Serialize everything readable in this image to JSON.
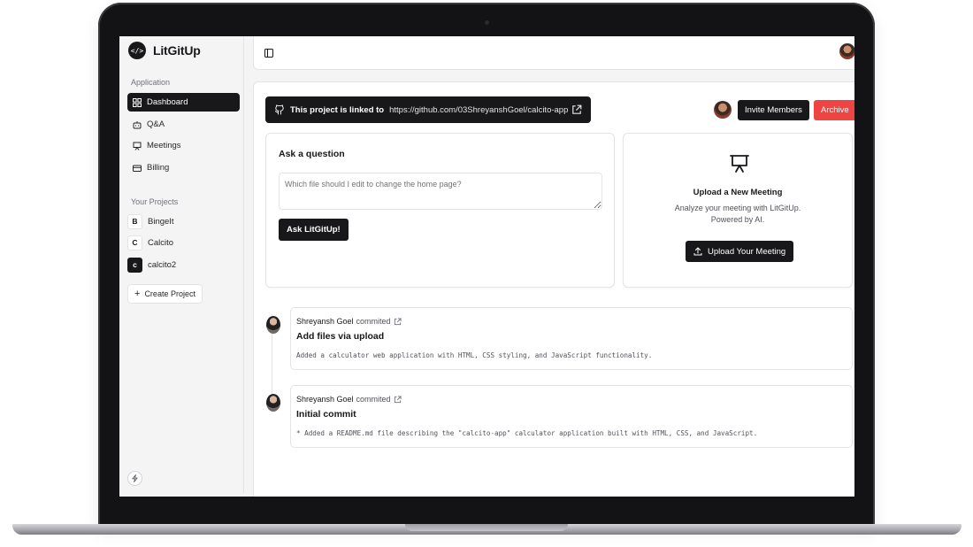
{
  "app": {
    "brand_name": "LitGitUp",
    "brand_logo_glyph": "</>"
  },
  "sidebar": {
    "application_label": "Application",
    "nav_items": [
      {
        "label": "Dashboard",
        "icon": "dashboard-icon",
        "active": true
      },
      {
        "label": "Q&A",
        "icon": "bot-icon",
        "active": false
      },
      {
        "label": "Meetings",
        "icon": "presentation-icon",
        "active": false
      },
      {
        "label": "Billing",
        "icon": "credit-card-icon",
        "active": false
      }
    ],
    "projects_label": "Your Projects",
    "projects": [
      {
        "initial": "B",
        "name": "BingeIt",
        "selected": false
      },
      {
        "initial": "C",
        "name": "Calcito",
        "selected": false
      },
      {
        "initial": "c",
        "name": "calcito2",
        "selected": true
      }
    ],
    "create_project_label": "Create Project"
  },
  "header": {
    "linked_prefix": "This project is linked to",
    "repo_url": "https://github.com/03ShreyanshGoel/calcito-app",
    "invite_label": "Invite Members",
    "archive_label": "Archive"
  },
  "ask": {
    "title": "Ask a question",
    "placeholder": "Which file should I edit to change the home page?",
    "button_label": "Ask LitGitUp!"
  },
  "upload": {
    "title": "Upload a New Meeting",
    "desc_line1": "Analyze your meeting with LitGitUp.",
    "desc_line2": "Powered by AI.",
    "button_label": "Upload Your Meeting"
  },
  "commits": [
    {
      "author": "Shreyansh Goel",
      "action": "commited",
      "title": "Add files via upload",
      "summary": "Added a calculator web application with HTML, CSS styling, and JavaScript functionality."
    },
    {
      "author": "Shreyansh Goel",
      "action": "commited",
      "title": "Initial commit",
      "summary": "* Added a README.md file describing the \"calcito-app\" calculator application built with HTML, CSS, and JavaScript."
    }
  ],
  "colors": {
    "primary": "#18181b",
    "danger": "#ef4444",
    "sidebar_bg": "#f4f4f5"
  }
}
